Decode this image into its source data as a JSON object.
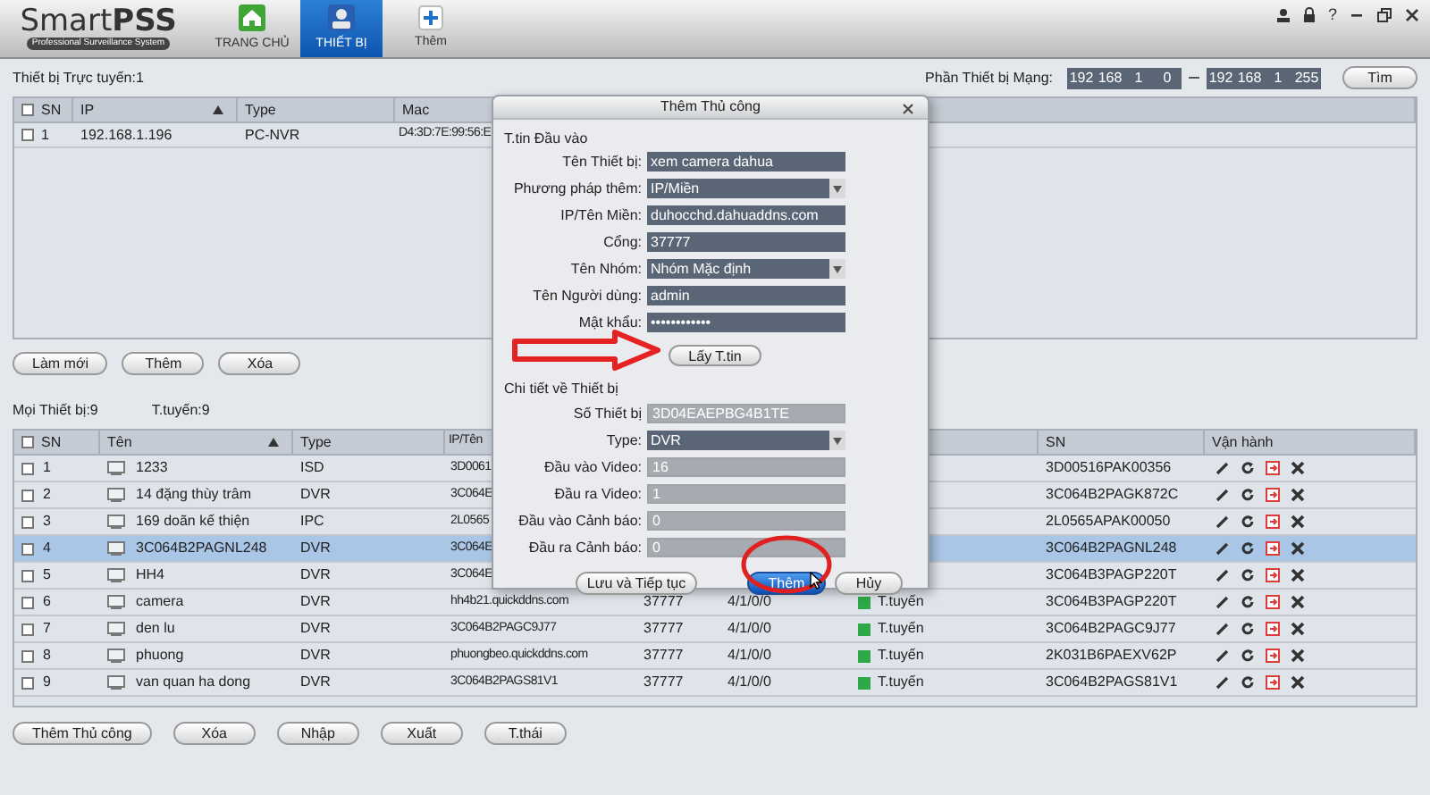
{
  "app": {
    "logo": "Smart**PSS**",
    "tagline": "Professional Surveillance System",
    "help_glyph": "?"
  },
  "nav_tabs": [
    {
      "label": "TRANG CHỦ",
      "selected": false,
      "kind": "home"
    },
    {
      "label": "THIẾT BỊ",
      "selected": true,
      "kind": "device"
    },
    {
      "label": "Thêm",
      "selected": false,
      "kind": "add"
    }
  ],
  "online_panel": {
    "title": "Thiết bị Trực tuyến:1",
    "segment_label": "Phần Thiết bị Mạng:",
    "ip_from": [
      "192",
      "168",
      "1",
      "0"
    ],
    "ip_to": [
      "192",
      "168",
      "1",
      "255"
    ],
    "search_button": "Tìm",
    "all_checked": false,
    "columns": [
      {
        "label": "SN",
        "sorted": false
      },
      {
        "label": "IP",
        "sorted": true
      },
      {
        "label": "Type",
        "sorted": false
      },
      {
        "label": "Mac",
        "sorted": false
      }
    ],
    "rows": [
      {
        "checked": false,
        "selected": false,
        "cells": [
          "1",
          "192.168.1.196",
          "PC-NVR",
          "D4:3D:7E:99:56:E"
        ]
      }
    ],
    "buttons": [
      "Làm mới",
      "Thêm",
      "Xóa"
    ]
  },
  "all_panel": {
    "total": "Mọi Thiết bị:9",
    "online": "T.tuyến:9",
    "all_checked": false,
    "columns": [
      {
        "label": "SN",
        "sorted": false
      },
      {
        "label": "Tên",
        "sorted": true
      },
      {
        "label": "Type",
        "sorted": false
      },
      {
        "label": "IP/Tên"
      },
      {
        "label": "SN",
        "sorted": false
      },
      {
        "label": "Vận hành",
        "sorted": false
      }
    ],
    "rows": [
      {
        "checked": false,
        "selected": false,
        "sn": "1",
        "name": "1233",
        "type": "ISD",
        "ip": "3D0061",
        "serial": "3D00516PAK00356"
      },
      {
        "checked": false,
        "selected": false,
        "sn": "2",
        "name": "14 đặng thùy trâm",
        "type": "DVR",
        "ip": "3C064E",
        "serial": "3C064B2PAGK872C"
      },
      {
        "checked": false,
        "selected": false,
        "sn": "3",
        "name": "169 doãn kế thiện",
        "type": "IPC",
        "ip": "2L0565",
        "serial": "2L0565APAK00050"
      },
      {
        "checked": false,
        "selected": true,
        "sn": "4",
        "name": "3C064B2PAGNL248",
        "type": "DVR",
        "ip": "3C064E",
        "serial": "3C064B2PAGNL248"
      },
      {
        "checked": false,
        "selected": false,
        "sn": "5",
        "name": "HH4",
        "type": "DVR",
        "ip": "3C064E",
        "serial": "3C064B3PAGP220T"
      },
      {
        "checked": false,
        "selected": false,
        "sn": "6",
        "name": "camera",
        "type": "DVR",
        "ip": "hh4b21.quickddns.com",
        "port": "37777",
        "channels": "4/1/0/0",
        "status": "T.tuyến",
        "serial": "3C064B3PAGP220T"
      },
      {
        "checked": false,
        "selected": false,
        "sn": "7",
        "name": "den lu",
        "type": "DVR",
        "ip": "3C064B2PAGC9J77",
        "port": "37777",
        "channels": "4/1/0/0",
        "status": "T.tuyến",
        "serial": "3C064B2PAGC9J77"
      },
      {
        "checked": false,
        "selected": false,
        "sn": "8",
        "name": "phuong",
        "type": "DVR",
        "ip": "phuongbeo.quickddns.com",
        "port": "37777",
        "channels": "4/1/0/0",
        "status": "T.tuyến",
        "serial": "2K031B6PAEXV62P"
      },
      {
        "checked": false,
        "selected": false,
        "sn": "9",
        "name": "van quan ha dong",
        "type": "DVR",
        "ip": "3C064B2PAGS81V1",
        "port": "37777",
        "channels": "4/1/0/0",
        "status": "T.tuyến",
        "serial": "3C064B2PAGS81V1"
      }
    ],
    "buttons": [
      "Thêm Thủ công",
      "Xóa",
      "Nhập",
      "Xuất",
      "T.thái"
    ]
  },
  "dialog": {
    "title": "Thêm Thủ công",
    "section_input": "T.tin Đầu vào",
    "fields": [
      {
        "label": "Tên Thiết bị:",
        "value": "xem camera dahua",
        "kind": "text"
      },
      {
        "label": "Phương pháp thêm:",
        "value": "IP/Miền",
        "kind": "select"
      },
      {
        "label": "IP/Tên Miền:",
        "value": "duhocchd.dahuaddns.com",
        "kind": "text"
      },
      {
        "label": "Cổng:",
        "value": "37777",
        "kind": "text"
      },
      {
        "label": "Tên Nhóm:",
        "value": "Nhóm Mặc định",
        "kind": "select"
      },
      {
        "label": "Tên Người dùng:",
        "value": "admin",
        "kind": "text"
      },
      {
        "label": "Mật khẩu:",
        "value": "••••••••••••",
        "kind": "text"
      }
    ],
    "fetch_button": "Lấy T.tin",
    "section_details": "Chi tiết về Thiết bị",
    "detail_fields": [
      {
        "label": "Số Thiết bị",
        "value": "3D04EAEPBG4B1TE",
        "kind": "disabled"
      },
      {
        "label": "Type:",
        "value": "DVR",
        "kind": "select"
      },
      {
        "label": "Đầu vào Video:",
        "value": "16",
        "kind": "disabled"
      },
      {
        "label": "Đầu ra Video:",
        "value": "1",
        "kind": "disabled"
      },
      {
        "label": "Đầu vào Cảnh báo:",
        "value": "0",
        "kind": "disabled"
      },
      {
        "label": "Đầu ra Cảnh báo:",
        "value": "0",
        "kind": "disabled"
      }
    ],
    "buttons": [
      {
        "label": "Lưu và Tiếp tục",
        "primary": false
      },
      {
        "label": "Thêm",
        "primary": true
      },
      {
        "label": "Hủy",
        "primary": false
      }
    ]
  }
}
